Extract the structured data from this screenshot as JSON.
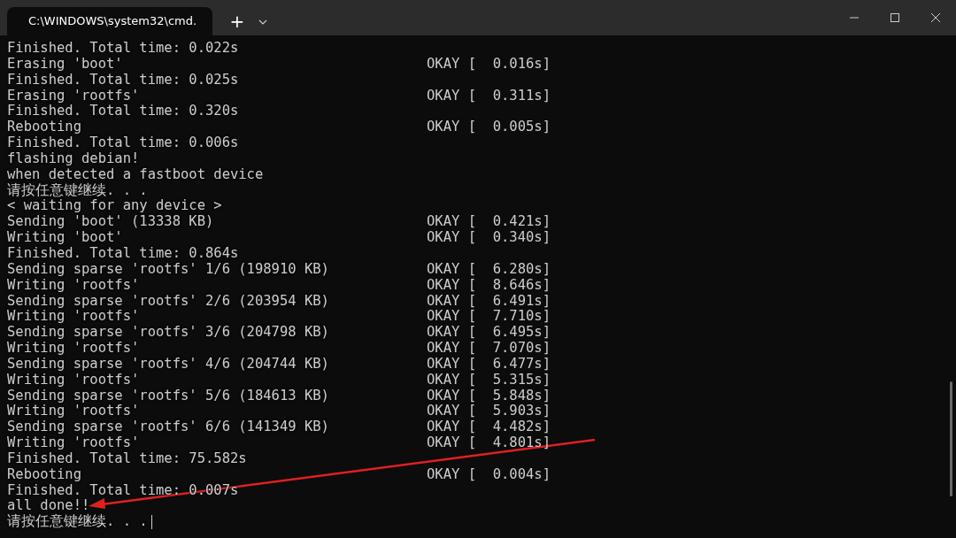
{
  "tab": {
    "title": "C:\\WINDOWS\\system32\\cmd.",
    "selected": true
  },
  "new_tab": "+",
  "lines": [
    {
      "text": "Finished. Total time: 0.022s"
    },
    {
      "text": "Erasing 'boot'",
      "status": "OKAY [  0.016s]"
    },
    {
      "text": "Finished. Total time: 0.025s"
    },
    {
      "text": "Erasing 'rootfs'",
      "status": "OKAY [  0.311s]"
    },
    {
      "text": "Finished. Total time: 0.320s"
    },
    {
      "text": "Rebooting",
      "status": "OKAY [  0.005s]"
    },
    {
      "text": "Finished. Total time: 0.006s"
    },
    {
      "text": "flashing debian!"
    },
    {
      "text": "when detected a fastboot device"
    },
    {
      "text": "请按任意键继续. . ."
    },
    {
      "text": "< waiting for any device >"
    },
    {
      "text": "Sending 'boot' (13338 KB)",
      "status": "OKAY [  0.421s]"
    },
    {
      "text": "Writing 'boot'",
      "status": "OKAY [  0.340s]"
    },
    {
      "text": "Finished. Total time: 0.864s"
    },
    {
      "text": "Sending sparse 'rootfs' 1/6 (198910 KB)",
      "status": "OKAY [  6.280s]"
    },
    {
      "text": "Writing 'rootfs'",
      "status": "OKAY [  8.646s]"
    },
    {
      "text": "Sending sparse 'rootfs' 2/6 (203954 KB)",
      "status": "OKAY [  6.491s]"
    },
    {
      "text": "Writing 'rootfs'",
      "status": "OKAY [  7.710s]"
    },
    {
      "text": "Sending sparse 'rootfs' 3/6 (204798 KB)",
      "status": "OKAY [  6.495s]"
    },
    {
      "text": "Writing 'rootfs'",
      "status": "OKAY [  7.070s]"
    },
    {
      "text": "Sending sparse 'rootfs' 4/6 (204744 KB)",
      "status": "OKAY [  6.477s]"
    },
    {
      "text": "Writing 'rootfs'",
      "status": "OKAY [  5.315s]"
    },
    {
      "text": "Sending sparse 'rootfs' 5/6 (184613 KB)",
      "status": "OKAY [  5.848s]"
    },
    {
      "text": "Writing 'rootfs'",
      "status": "OKAY [  5.903s]"
    },
    {
      "text": "Sending sparse 'rootfs' 6/6 (141349 KB)",
      "status": "OKAY [  4.482s]"
    },
    {
      "text": "Writing 'rootfs'",
      "status": "OKAY [  4.801s]"
    },
    {
      "text": "Finished. Total time: 75.582s"
    },
    {
      "text": "Rebooting",
      "status": "OKAY [  0.004s]"
    },
    {
      "text": "Finished. Total time: 0.007s"
    },
    {
      "text": "all done!!"
    },
    {
      "text": "请按任意键继续. . .",
      "cursor": true
    }
  ]
}
